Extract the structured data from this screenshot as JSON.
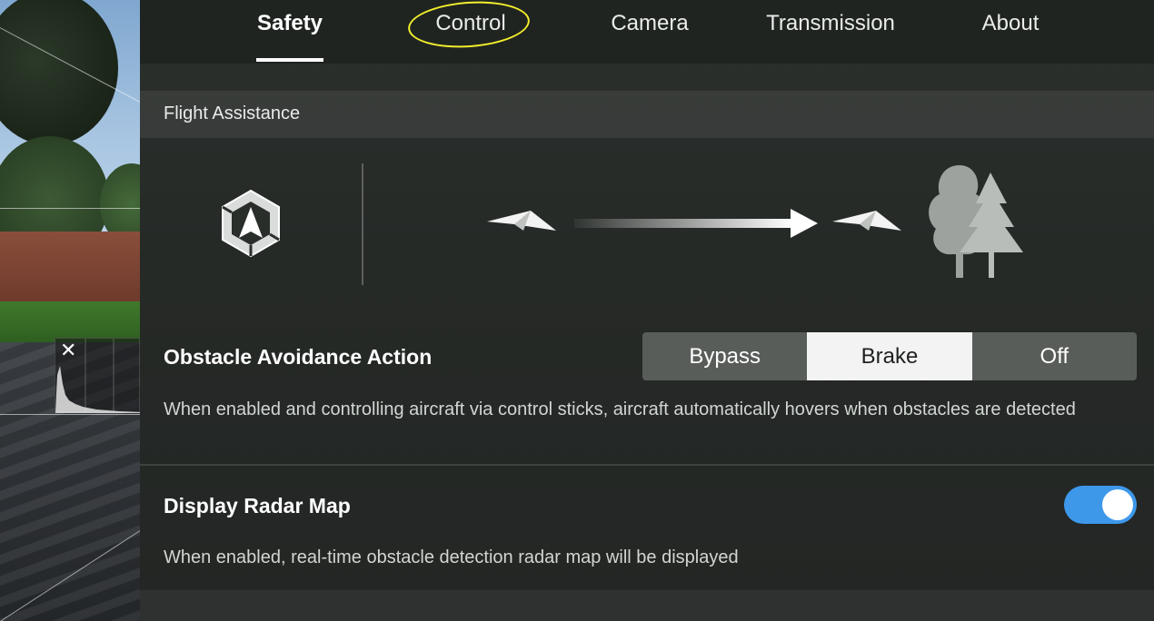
{
  "tabs": [
    {
      "label": "Safety",
      "active": true
    },
    {
      "label": "Control",
      "active": false
    },
    {
      "label": "Camera",
      "active": false
    },
    {
      "label": "Transmission",
      "active": false
    },
    {
      "label": "About",
      "active": false
    }
  ],
  "section": {
    "title": "Flight Assistance"
  },
  "obstacle_avoidance": {
    "title": "Obstacle Avoidance Action",
    "options": [
      "Bypass",
      "Brake",
      "Off"
    ],
    "selected": "Brake",
    "description": "When enabled and controlling aircraft via control sticks, aircraft automatically hovers when obstacles are detected"
  },
  "radar_map": {
    "title": "Display Radar Map",
    "enabled": true,
    "description": "When enabled, real-time obstacle detection radar map will be displayed"
  },
  "histogram": {
    "close_glyph": "✕"
  },
  "colors": {
    "toggle_on": "#3d98ea",
    "annotation_circle": "#f3ee2c",
    "selected_segment": "#f2f3f2"
  },
  "icons": {
    "logo": "vision-system-icon",
    "aircraft": "paper-plane-icon",
    "arrow": "arrow-right-icon",
    "obstacle": "trees-icon"
  }
}
